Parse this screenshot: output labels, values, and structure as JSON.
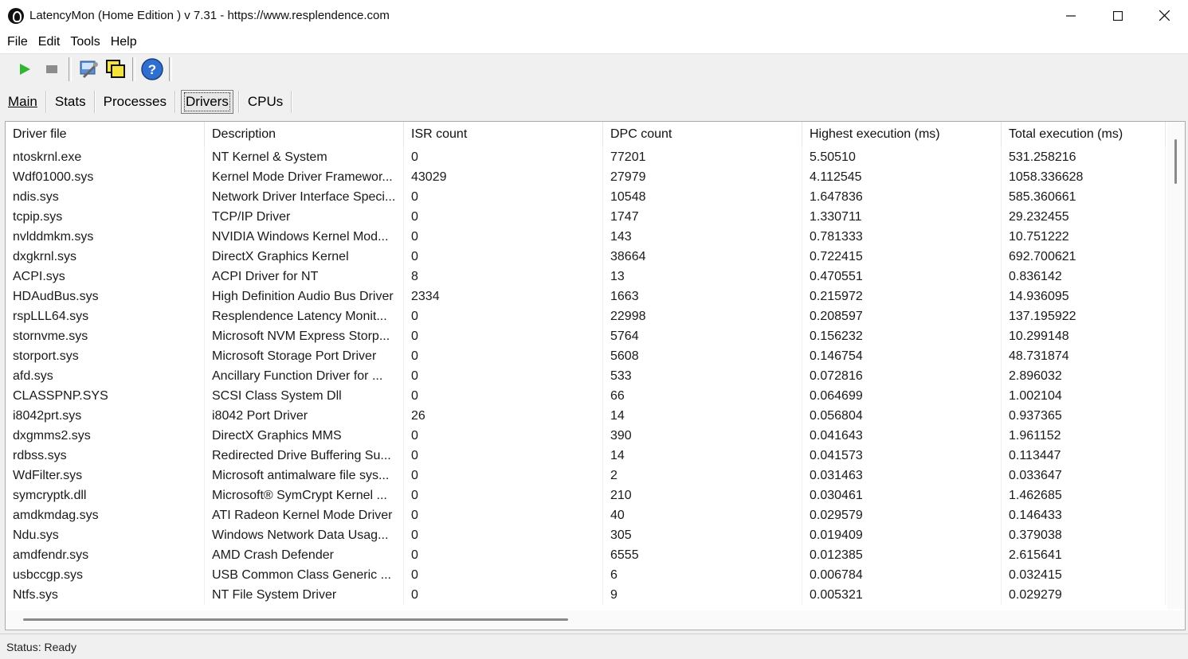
{
  "window": {
    "title": "LatencyMon  (Home Edition )  v 7.31 - https://www.resplendence.com"
  },
  "menu": [
    "File",
    "Edit",
    "Tools",
    "Help"
  ],
  "toolbar": {
    "icons": [
      "play-icon",
      "stop-icon",
      "tools-icon",
      "copy-icon",
      "help-icon"
    ]
  },
  "tabs": [
    {
      "label": "Main",
      "active": false
    },
    {
      "label": "Stats",
      "active": false
    },
    {
      "label": "Processes",
      "active": false
    },
    {
      "label": "Drivers",
      "active": true
    },
    {
      "label": "CPUs",
      "active": false
    }
  ],
  "table": {
    "columns": [
      "Driver file",
      "Description",
      "ISR count",
      "DPC count",
      "Highest execution (ms)",
      "Total execution (ms)"
    ],
    "rows": [
      [
        "ntoskrnl.exe",
        "NT Kernel & System",
        "0",
        "77201",
        "5.50510",
        "531.258216"
      ],
      [
        "Wdf01000.sys",
        "Kernel Mode Driver Framewor...",
        "43029",
        "27979",
        "4.112545",
        "1058.336628"
      ],
      [
        "ndis.sys",
        "Network Driver Interface Speci...",
        "0",
        "10548",
        "1.647836",
        "585.360661"
      ],
      [
        "tcpip.sys",
        "TCP/IP Driver",
        "0",
        "1747",
        "1.330711",
        "29.232455"
      ],
      [
        "nvlddmkm.sys",
        "NVIDIA Windows Kernel Mod...",
        "0",
        "143",
        "0.781333",
        "10.751222"
      ],
      [
        "dxgkrnl.sys",
        "DirectX Graphics Kernel",
        "0",
        "38664",
        "0.722415",
        "692.700621"
      ],
      [
        "ACPI.sys",
        "ACPI Driver for NT",
        "8",
        "13",
        "0.470551",
        "0.836142"
      ],
      [
        "HDAudBus.sys",
        "High Definition Audio Bus Driver",
        "2334",
        "1663",
        "0.215972",
        "14.936095"
      ],
      [
        "rspLLL64.sys",
        "Resplendence Latency Monit...",
        "0",
        "22998",
        "0.208597",
        "137.195922"
      ],
      [
        "stornvme.sys",
        "Microsoft NVM Express Storp...",
        "0",
        "5764",
        "0.156232",
        "10.299148"
      ],
      [
        "storport.sys",
        "Microsoft Storage Port Driver",
        "0",
        "5608",
        "0.146754",
        "48.731874"
      ],
      [
        "afd.sys",
        "Ancillary Function Driver for ...",
        "0",
        "533",
        "0.072816",
        "2.896032"
      ],
      [
        "CLASSPNP.SYS",
        "SCSI Class System Dll",
        "0",
        "66",
        "0.064699",
        "1.002104"
      ],
      [
        "i8042prt.sys",
        "i8042 Port Driver",
        "26",
        "14",
        "0.056804",
        "0.937365"
      ],
      [
        "dxgmms2.sys",
        "DirectX Graphics MMS",
        "0",
        "390",
        "0.041643",
        "1.961152"
      ],
      [
        "rdbss.sys",
        "Redirected Drive Buffering Su...",
        "0",
        "14",
        "0.041573",
        "0.113447"
      ],
      [
        "WdFilter.sys",
        "Microsoft antimalware file sys...",
        "0",
        "2",
        "0.031463",
        "0.033647"
      ],
      [
        "symcryptk.dll",
        "Microsoft® SymCrypt Kernel ...",
        "0",
        "210",
        "0.030461",
        "1.462685"
      ],
      [
        "amdkmdag.sys",
        "ATI Radeon Kernel Mode Driver",
        "0",
        "40",
        "0.029579",
        "0.146433"
      ],
      [
        "Ndu.sys",
        "Windows Network Data Usag...",
        "0",
        "305",
        "0.019409",
        "0.379038"
      ],
      [
        "amdfendr.sys",
        "AMD Crash Defender",
        "0",
        "6555",
        "0.012385",
        "2.615641"
      ],
      [
        "usbccgp.sys",
        "USB Common Class Generic ...",
        "0",
        "6",
        "0.006784",
        "0.032415"
      ],
      [
        "Ntfs.sys",
        "NT File System Driver",
        "0",
        "9",
        "0.005321",
        "0.029279"
      ]
    ]
  },
  "status": "Status: Ready"
}
